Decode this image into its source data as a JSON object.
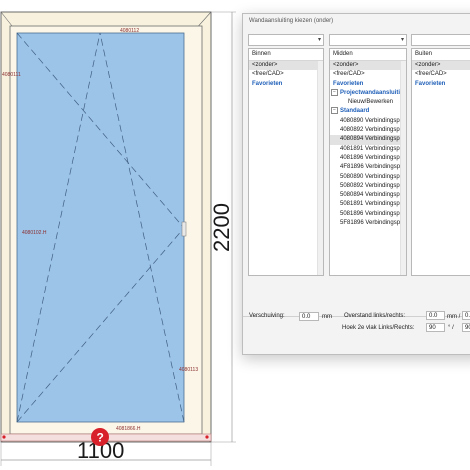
{
  "drawing": {
    "profile_top": "4080112",
    "profile_left": "4080111",
    "profile_center": "4080102.H",
    "profile_right": "4080113",
    "profile_bottom": "4081866.H",
    "dim_height": "2200",
    "dim_width": "1100",
    "warning_symbol": "?"
  },
  "dialog": {
    "title": "Wandaansluiting kiezen (onder)",
    "columns": [
      {
        "header": "Binnen",
        "items": [
          {
            "label": "<zonder>",
            "style": "sel"
          },
          {
            "label": "<free/CAD>",
            "style": ""
          },
          {
            "label": "Favorieten",
            "style": "fav"
          }
        ]
      },
      {
        "header": "Midden",
        "items": [
          {
            "label": "<zonder>",
            "style": "sel"
          },
          {
            "label": "<free/CAD>",
            "style": ""
          },
          {
            "label": "Favorieten",
            "style": "fav"
          },
          {
            "label": "Projectwandaansluiting",
            "style": "grp"
          },
          {
            "label": "Nieuw/Bewerken",
            "style": "ind"
          },
          {
            "label": "Standaard",
            "style": "grp"
          },
          {
            "label": "4080890 Verbindingsp...",
            "style": "ind2"
          },
          {
            "label": "4080892 Verbindingsp...",
            "style": "ind2"
          },
          {
            "label": "4080894 Verbindingsp...",
            "style": "ind2 sel"
          },
          {
            "label": "4081891 Verbindingsp...",
            "style": "ind2"
          },
          {
            "label": "4081896 Verbindingsp...",
            "style": "ind2"
          },
          {
            "label": "4F81896 Verbindingsp...",
            "style": "ind2"
          },
          {
            "label": "5080890 Verbindingsp...",
            "style": "ind2"
          },
          {
            "label": "5080892 Verbindingsp...",
            "style": "ind2"
          },
          {
            "label": "5080894 Verbindingsp...",
            "style": "ind2"
          },
          {
            "label": "5081891 Verbindingsp...",
            "style": "ind2"
          },
          {
            "label": "5081896 Verbindingsp...",
            "style": "ind2"
          },
          {
            "label": "5F81896 Verbindingsp...",
            "style": "ind2"
          }
        ]
      },
      {
        "header": "Buiten",
        "items": [
          {
            "label": "<zonder>",
            "style": "sel"
          },
          {
            "label": "<free/CAD>",
            "style": ""
          },
          {
            "label": "Favorieten",
            "style": "fav"
          }
        ]
      }
    ],
    "bottom": {
      "verschuiving_label": "Verschuiving:",
      "verschuiving_value": "0.0",
      "mm_1": "mm",
      "overstand_label": "Overstand links/rechts:",
      "overstand_left": "0.0",
      "mm_2": "mm /",
      "overstand_right": "0.0",
      "hoek_label": "Hoek 2e vlak Links/Rechts:",
      "hoek_left": "90",
      "deg_sep": "° /",
      "hoek_right": "90"
    }
  },
  "colors": {
    "glass": "#9cc3e8",
    "frame": "#f7f1de",
    "frame_line": "#6b6b6b",
    "profile_text": "#8b2f2f",
    "warning": "#d8202a",
    "link_blue": "#1f5fb8"
  }
}
